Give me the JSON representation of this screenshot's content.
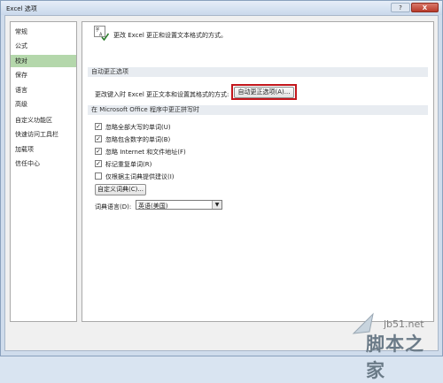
{
  "window": {
    "title": "Excel 选项",
    "help": "?",
    "close": "X"
  },
  "sidebar": {
    "items": [
      {
        "label": "常规"
      },
      {
        "label": "公式"
      },
      {
        "label": "校对"
      },
      {
        "label": "保存"
      },
      {
        "label": "语言"
      },
      {
        "label": "高级"
      },
      {
        "label": "自定义功能区"
      },
      {
        "label": "快速访问工具栏"
      },
      {
        "label": "加载项"
      },
      {
        "label": "信任中心"
      }
    ],
    "selected": "校对"
  },
  "content": {
    "header": {
      "icon": "proofing-abc-check-icon",
      "text": "更改 Excel 更正和设置文本格式的方式。"
    },
    "autocorrect_section": {
      "title": "自动更正选项",
      "label": "更改键入时 Excel 更正文本和设置其格式的方式:",
      "button": "自动更正选项(A)..."
    },
    "spelling_section": {
      "title": "在 Microsoft Office 程序中更正拼写时",
      "checkboxes": [
        {
          "label": "忽略全部大写的单词(U)",
          "checked": true
        },
        {
          "label": "忽略包含数字的单词(B)",
          "checked": true
        },
        {
          "label": "忽略 Internet 和文件地址(F)",
          "checked": true
        },
        {
          "label": "标记重复单词(R)",
          "checked": true
        },
        {
          "label": "仅根据主词典提供建议(I)",
          "checked": false
        }
      ],
      "custom_dict_button": "自定义词典(C)...",
      "dictionary_language_label": "词典语言(D):",
      "dictionary_language_value": "英语(美国)"
    }
  },
  "watermark": {
    "url": "jb51.net",
    "name": "脚本之家"
  },
  "colors": {
    "selected_nav": "#b4d7ab",
    "highlight": "#c3161c",
    "close_button": "#c6493a"
  }
}
